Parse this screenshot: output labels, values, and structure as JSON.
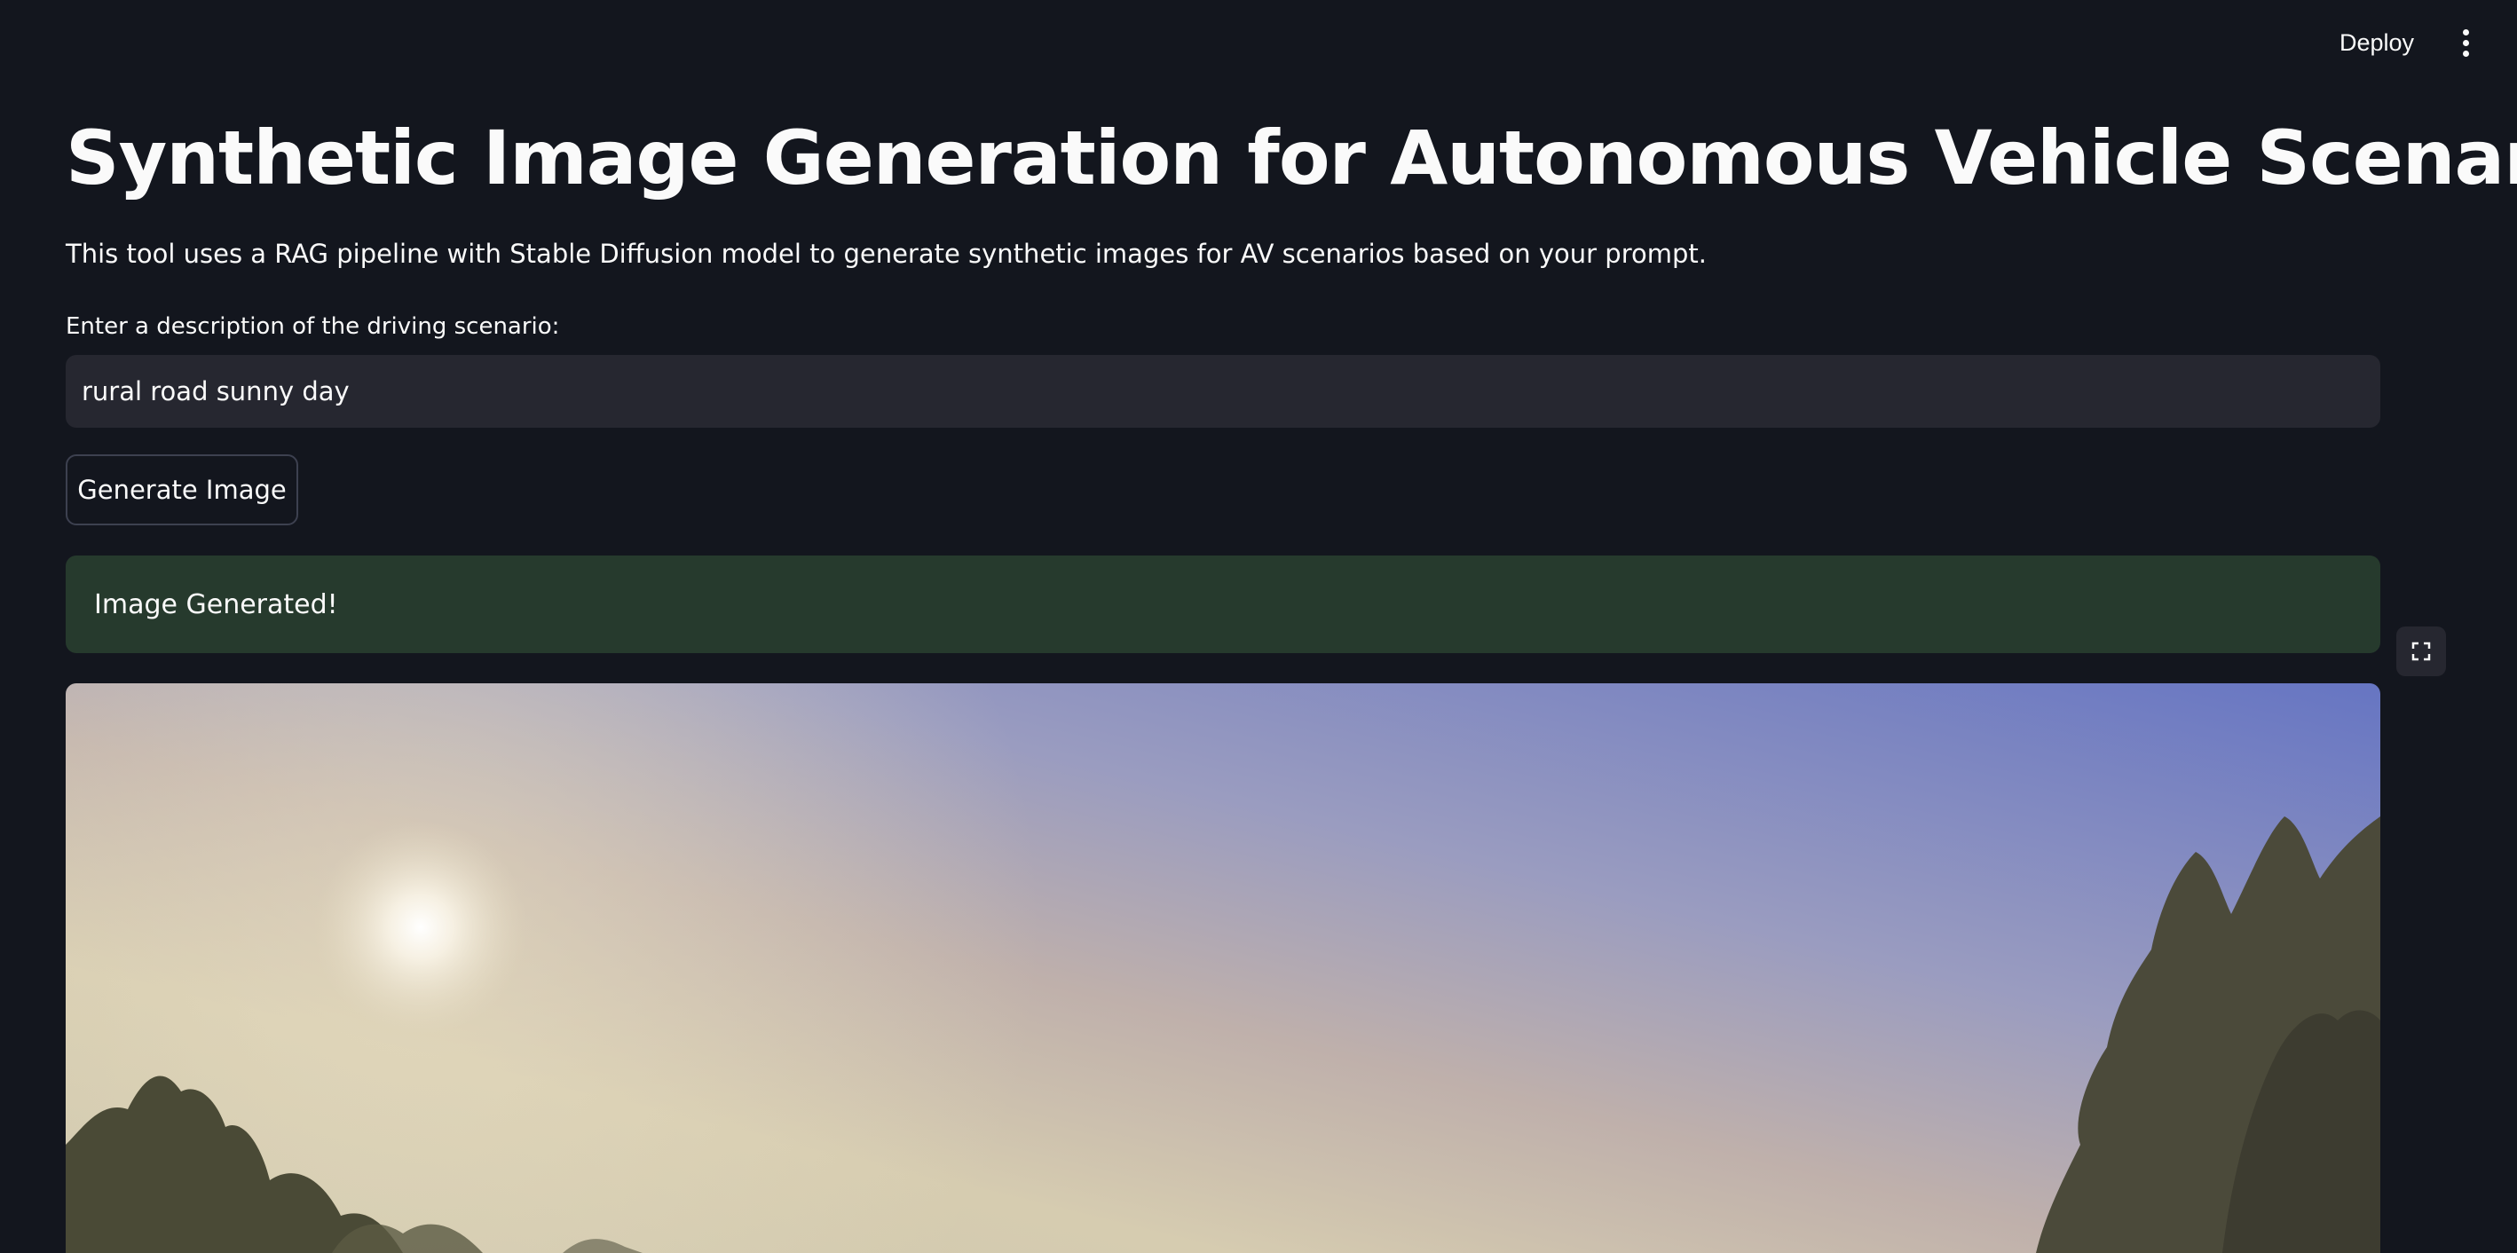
{
  "header": {
    "deploy_label": "Deploy",
    "menu_icon": "more-vertical-icon"
  },
  "main": {
    "title": "Synthetic Image Generation for Autonomous Vehicle Scenarios",
    "subtitle": "This tool uses a RAG pipeline with Stable Diffusion model to generate synthetic images for AV scenarios based on your prompt.",
    "input": {
      "label": "Enter a description of the driving scenario:",
      "value": "rural road sunny day",
      "placeholder": ""
    },
    "generate_button": "Generate Image",
    "alert": {
      "message": "Image Generated!",
      "color": "#263a2d"
    },
    "fullscreen_icon": "fullscreen-icon"
  },
  "colors": {
    "background": "#13161e",
    "input_background": "#262730",
    "text": "#fafafa",
    "button_border": "#3d4150",
    "success_background": "#263a2d"
  }
}
